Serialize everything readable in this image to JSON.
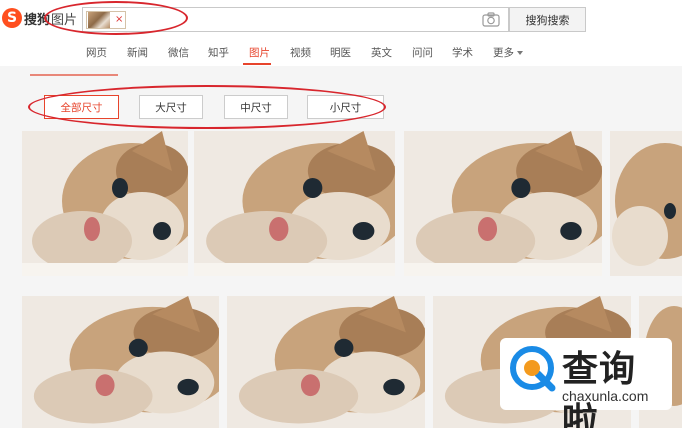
{
  "header": {
    "logo_letter": "S",
    "logo_text": "搜狗",
    "logo_sub": "图片",
    "search_chip_close": "×",
    "search_button": "搜狗搜索",
    "camera_icon": "camera-icon"
  },
  "nav": {
    "items": [
      "网页",
      "新闻",
      "微信",
      "知乎",
      "图片",
      "视频",
      "明医",
      "英文",
      "问问",
      "学术",
      "更多"
    ],
    "active": "图片"
  },
  "size_filter": {
    "options": [
      "全部尺寸",
      "大尺寸",
      "中尺寸",
      "小尺寸"
    ],
    "active": "全部尺寸"
  },
  "watermark": {
    "brand": "查询啦",
    "url": "chaxunla.com"
  },
  "colors": {
    "accent": "#e7442c",
    "annotation_red": "#d8262d",
    "watermark_blue": "#1a8be6",
    "watermark_orange": "#f39a1e"
  }
}
